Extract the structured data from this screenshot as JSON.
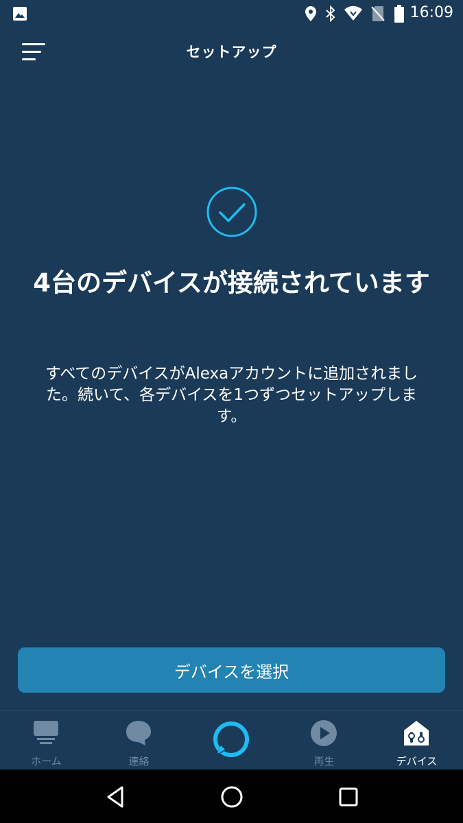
{
  "status_bar": {
    "time": "16:09",
    "icons": [
      "image-icon",
      "location-icon",
      "bluetooth-icon",
      "wifi-icon",
      "no-sim-icon",
      "battery-icon"
    ]
  },
  "app_bar": {
    "title": "セットアップ",
    "menu_icon": "menu-icon"
  },
  "main": {
    "status_icon": "check-circle-icon",
    "headline": "4台のデバイスが接続されています",
    "body": "すべてのデバイスがAlexaアカウントに追加されました。続いて、各デバイスを1つずつセットアップします。",
    "primary_button": "デバイスを選択"
  },
  "bottom_nav": {
    "items": [
      {
        "label": "ホーム",
        "icon": "home-icon",
        "active": false
      },
      {
        "label": "連絡",
        "icon": "chat-icon",
        "active": false
      },
      {
        "label": "",
        "icon": "alexa-icon",
        "active": false
      },
      {
        "label": "再生",
        "icon": "play-icon",
        "active": false
      },
      {
        "label": "デバイス",
        "icon": "devices-icon",
        "active": true
      }
    ]
  },
  "system_nav": {
    "icons": [
      "back-icon",
      "home-circle-icon",
      "recents-icon"
    ]
  },
  "colors": {
    "background": "#1a3a57",
    "accent": "#1ebcf2",
    "button": "#2383b3",
    "inactive": "#6f8aa2"
  }
}
